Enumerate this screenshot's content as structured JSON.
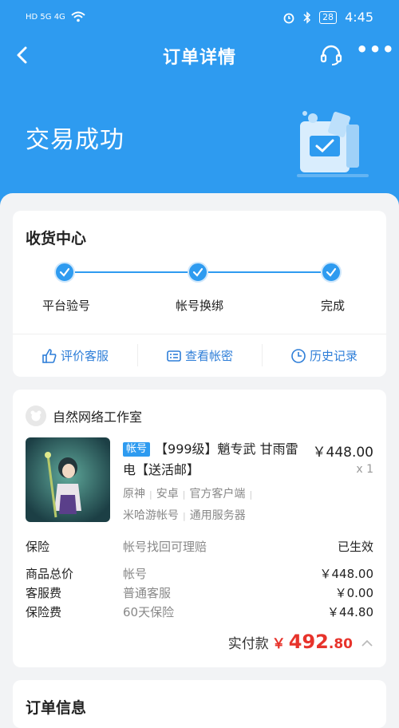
{
  "statusbar": {
    "time": "4:45",
    "battery": "28",
    "left_text": "HD 5G 4G"
  },
  "navbar": {
    "title": "订单详情",
    "more": "•••"
  },
  "hero": {
    "status": "交易成功"
  },
  "receive": {
    "title": "收货中心",
    "steps": [
      {
        "label": "平台验号"
      },
      {
        "label": "帐号换绑"
      },
      {
        "label": "完成"
      }
    ],
    "actions": [
      {
        "label": "评价客服",
        "icon": "thumbs-up-icon"
      },
      {
        "label": "查看帐密",
        "icon": "account-card-icon"
      },
      {
        "label": "历史记录",
        "icon": "clock-icon"
      }
    ]
  },
  "order": {
    "shop_name": "自然网络工作室",
    "tag": "帐号",
    "product_title": "【999级】魈专武 甘雨雷电【送活邮】",
    "price": "￥448.00",
    "qty": "x 1",
    "attrs_line1": [
      "原神",
      "安卓",
      "官方客户端"
    ],
    "attrs_line2": [
      "米哈游帐号",
      "通用服务器"
    ],
    "rows": {
      "insurance": {
        "label": "保险",
        "mid": "帐号找回可理赔",
        "value": "已生效"
      },
      "total": {
        "label": "商品总价",
        "mid": "帐号",
        "value": "￥448.00"
      },
      "service": {
        "label": "客服费",
        "mid": "普通客服",
        "value": "￥0.00"
      },
      "insurance_fee": {
        "label": "保险费",
        "mid": "60天保险",
        "value": "￥44.80"
      }
    },
    "paid": {
      "label": "实付款",
      "yen": "￥",
      "int": "492",
      "dec": ".80"
    }
  },
  "order_info": {
    "title": "订单信息"
  },
  "colors": {
    "primary": "#2e9bf0",
    "price_red": "#e7332b",
    "link_blue": "#2e7ed8"
  }
}
